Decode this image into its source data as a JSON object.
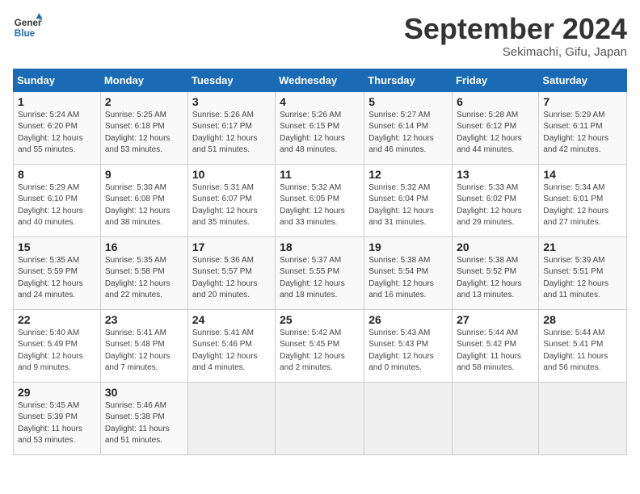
{
  "header": {
    "logo_line1": "General",
    "logo_line2": "Blue",
    "month": "September 2024",
    "location": "Sekimachi, Gifu, Japan"
  },
  "weekdays": [
    "Sunday",
    "Monday",
    "Tuesday",
    "Wednesday",
    "Thursday",
    "Friday",
    "Saturday"
  ],
  "weeks": [
    [
      {
        "day": "1",
        "detail": "Sunrise: 5:24 AM\nSunset: 6:20 PM\nDaylight: 12 hours\nand 55 minutes."
      },
      {
        "day": "2",
        "detail": "Sunrise: 5:25 AM\nSunset: 6:18 PM\nDaylight: 12 hours\nand 53 minutes."
      },
      {
        "day": "3",
        "detail": "Sunrise: 5:26 AM\nSunset: 6:17 PM\nDaylight: 12 hours\nand 51 minutes."
      },
      {
        "day": "4",
        "detail": "Sunrise: 5:26 AM\nSunset: 6:15 PM\nDaylight: 12 hours\nand 48 minutes."
      },
      {
        "day": "5",
        "detail": "Sunrise: 5:27 AM\nSunset: 6:14 PM\nDaylight: 12 hours\nand 46 minutes."
      },
      {
        "day": "6",
        "detail": "Sunrise: 5:28 AM\nSunset: 6:12 PM\nDaylight: 12 hours\nand 44 minutes."
      },
      {
        "day": "7",
        "detail": "Sunrise: 5:29 AM\nSunset: 6:11 PM\nDaylight: 12 hours\nand 42 minutes."
      }
    ],
    [
      {
        "day": "8",
        "detail": "Sunrise: 5:29 AM\nSunset: 6:10 PM\nDaylight: 12 hours\nand 40 minutes."
      },
      {
        "day": "9",
        "detail": "Sunrise: 5:30 AM\nSunset: 6:08 PM\nDaylight: 12 hours\nand 38 minutes."
      },
      {
        "day": "10",
        "detail": "Sunrise: 5:31 AM\nSunset: 6:07 PM\nDaylight: 12 hours\nand 35 minutes."
      },
      {
        "day": "11",
        "detail": "Sunrise: 5:32 AM\nSunset: 6:05 PM\nDaylight: 12 hours\nand 33 minutes."
      },
      {
        "day": "12",
        "detail": "Sunrise: 5:32 AM\nSunset: 6:04 PM\nDaylight: 12 hours\nand 31 minutes."
      },
      {
        "day": "13",
        "detail": "Sunrise: 5:33 AM\nSunset: 6:02 PM\nDaylight: 12 hours\nand 29 minutes."
      },
      {
        "day": "14",
        "detail": "Sunrise: 5:34 AM\nSunset: 6:01 PM\nDaylight: 12 hours\nand 27 minutes."
      }
    ],
    [
      {
        "day": "15",
        "detail": "Sunrise: 5:35 AM\nSunset: 5:59 PM\nDaylight: 12 hours\nand 24 minutes."
      },
      {
        "day": "16",
        "detail": "Sunrise: 5:35 AM\nSunset: 5:58 PM\nDaylight: 12 hours\nand 22 minutes."
      },
      {
        "day": "17",
        "detail": "Sunrise: 5:36 AM\nSunset: 5:57 PM\nDaylight: 12 hours\nand 20 minutes."
      },
      {
        "day": "18",
        "detail": "Sunrise: 5:37 AM\nSunset: 5:55 PM\nDaylight: 12 hours\nand 18 minutes."
      },
      {
        "day": "19",
        "detail": "Sunrise: 5:38 AM\nSunset: 5:54 PM\nDaylight: 12 hours\nand 16 minutes."
      },
      {
        "day": "20",
        "detail": "Sunrise: 5:38 AM\nSunset: 5:52 PM\nDaylight: 12 hours\nand 13 minutes."
      },
      {
        "day": "21",
        "detail": "Sunrise: 5:39 AM\nSunset: 5:51 PM\nDaylight: 12 hours\nand 11 minutes."
      }
    ],
    [
      {
        "day": "22",
        "detail": "Sunrise: 5:40 AM\nSunset: 5:49 PM\nDaylight: 12 hours\nand 9 minutes."
      },
      {
        "day": "23",
        "detail": "Sunrise: 5:41 AM\nSunset: 5:48 PM\nDaylight: 12 hours\nand 7 minutes."
      },
      {
        "day": "24",
        "detail": "Sunrise: 5:41 AM\nSunset: 5:46 PM\nDaylight: 12 hours\nand 4 minutes."
      },
      {
        "day": "25",
        "detail": "Sunrise: 5:42 AM\nSunset: 5:45 PM\nDaylight: 12 hours\nand 2 minutes."
      },
      {
        "day": "26",
        "detail": "Sunrise: 5:43 AM\nSunset: 5:43 PM\nDaylight: 12 hours\nand 0 minutes."
      },
      {
        "day": "27",
        "detail": "Sunrise: 5:44 AM\nSunset: 5:42 PM\nDaylight: 11 hours\nand 58 minutes."
      },
      {
        "day": "28",
        "detail": "Sunrise: 5:44 AM\nSunset: 5:41 PM\nDaylight: 11 hours\nand 56 minutes."
      }
    ],
    [
      {
        "day": "29",
        "detail": "Sunrise: 5:45 AM\nSunset: 5:39 PM\nDaylight: 11 hours\nand 53 minutes."
      },
      {
        "day": "30",
        "detail": "Sunrise: 5:46 AM\nSunset: 5:38 PM\nDaylight: 11 hours\nand 51 minutes."
      },
      {
        "day": "",
        "detail": ""
      },
      {
        "day": "",
        "detail": ""
      },
      {
        "day": "",
        "detail": ""
      },
      {
        "day": "",
        "detail": ""
      },
      {
        "day": "",
        "detail": ""
      }
    ]
  ]
}
